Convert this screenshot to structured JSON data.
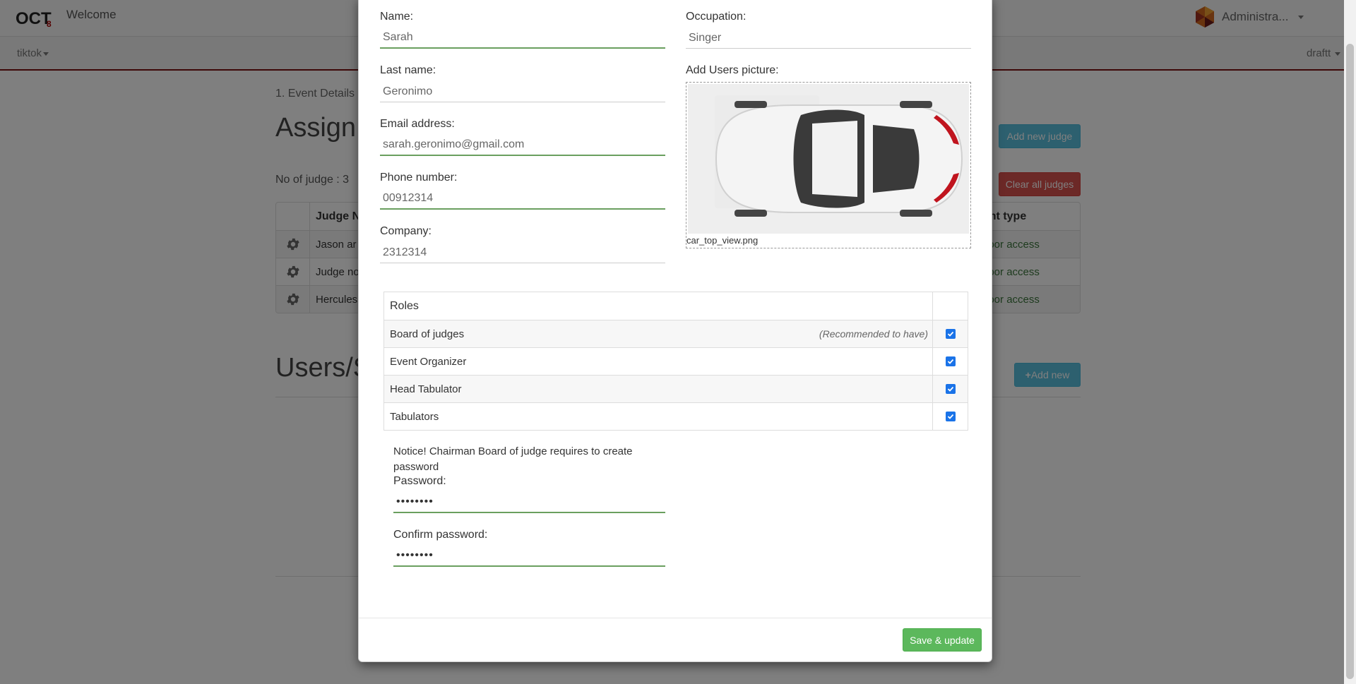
{
  "app": {
    "welcome": "Welcome",
    "admin_name": "Administra...",
    "event_menu": "tiktok",
    "draft_menu": "draftt"
  },
  "page": {
    "breadcrumb": "1. Event Details",
    "assign_title": "Assign J",
    "add_judge_label": "Add new judge",
    "clear_judges_label": "Clear all judges",
    "no_of_judge": "No of judge : 3",
    "users_title": "Users/S",
    "add_new_label": "Add new"
  },
  "judges_table": {
    "header_name": "Judge Na",
    "header_type": "unt type",
    "rows": [
      {
        "name": "Jason ar",
        "type": "door access"
      },
      {
        "name": "Judge no",
        "type": "door access"
      },
      {
        "name": "Hercules",
        "type": "door access"
      }
    ]
  },
  "modal": {
    "name_label": "Name:",
    "name_value": "Sarah",
    "last_name_label": "Last name:",
    "last_name_value": "Geronimo",
    "email_label": "Email address:",
    "email_value": "sarah.geronimo@gmail.com",
    "phone_label": "Phone number:",
    "phone_value": "00912314",
    "company_label": "Company:",
    "company_value": "2312314",
    "occupation_label": "Occupation:",
    "occupation_value": "Singer",
    "picture_label": "Add Users picture:",
    "picture_filename": "car_top_view.png",
    "roles_header": "Roles",
    "roles": [
      {
        "label": "Board of judges",
        "note": "(Recommended to have)",
        "checked": true
      },
      {
        "label": "Event Organizer",
        "note": "",
        "checked": true
      },
      {
        "label": "Head Tabulator",
        "note": "",
        "checked": true
      },
      {
        "label": "Tabulators",
        "note": "",
        "checked": true
      }
    ],
    "notice": "Notice! Chairman Board of judge requires to create password",
    "password_label": "Password:",
    "password_value": "••••••••",
    "confirm_label": "Confirm password:",
    "confirm_value": "••••••••",
    "save_label": "Save & update"
  },
  "colors": {
    "info": "#5bc0de",
    "danger": "#d9534f",
    "success": "#5cb85c",
    "valid_underline": "#6a9f5f",
    "checkbox": "#1a73e8"
  },
  "icons": [
    "logo-icon",
    "avatar-icon",
    "gear-icon",
    "plus-icon",
    "check-icon",
    "car-image"
  ]
}
